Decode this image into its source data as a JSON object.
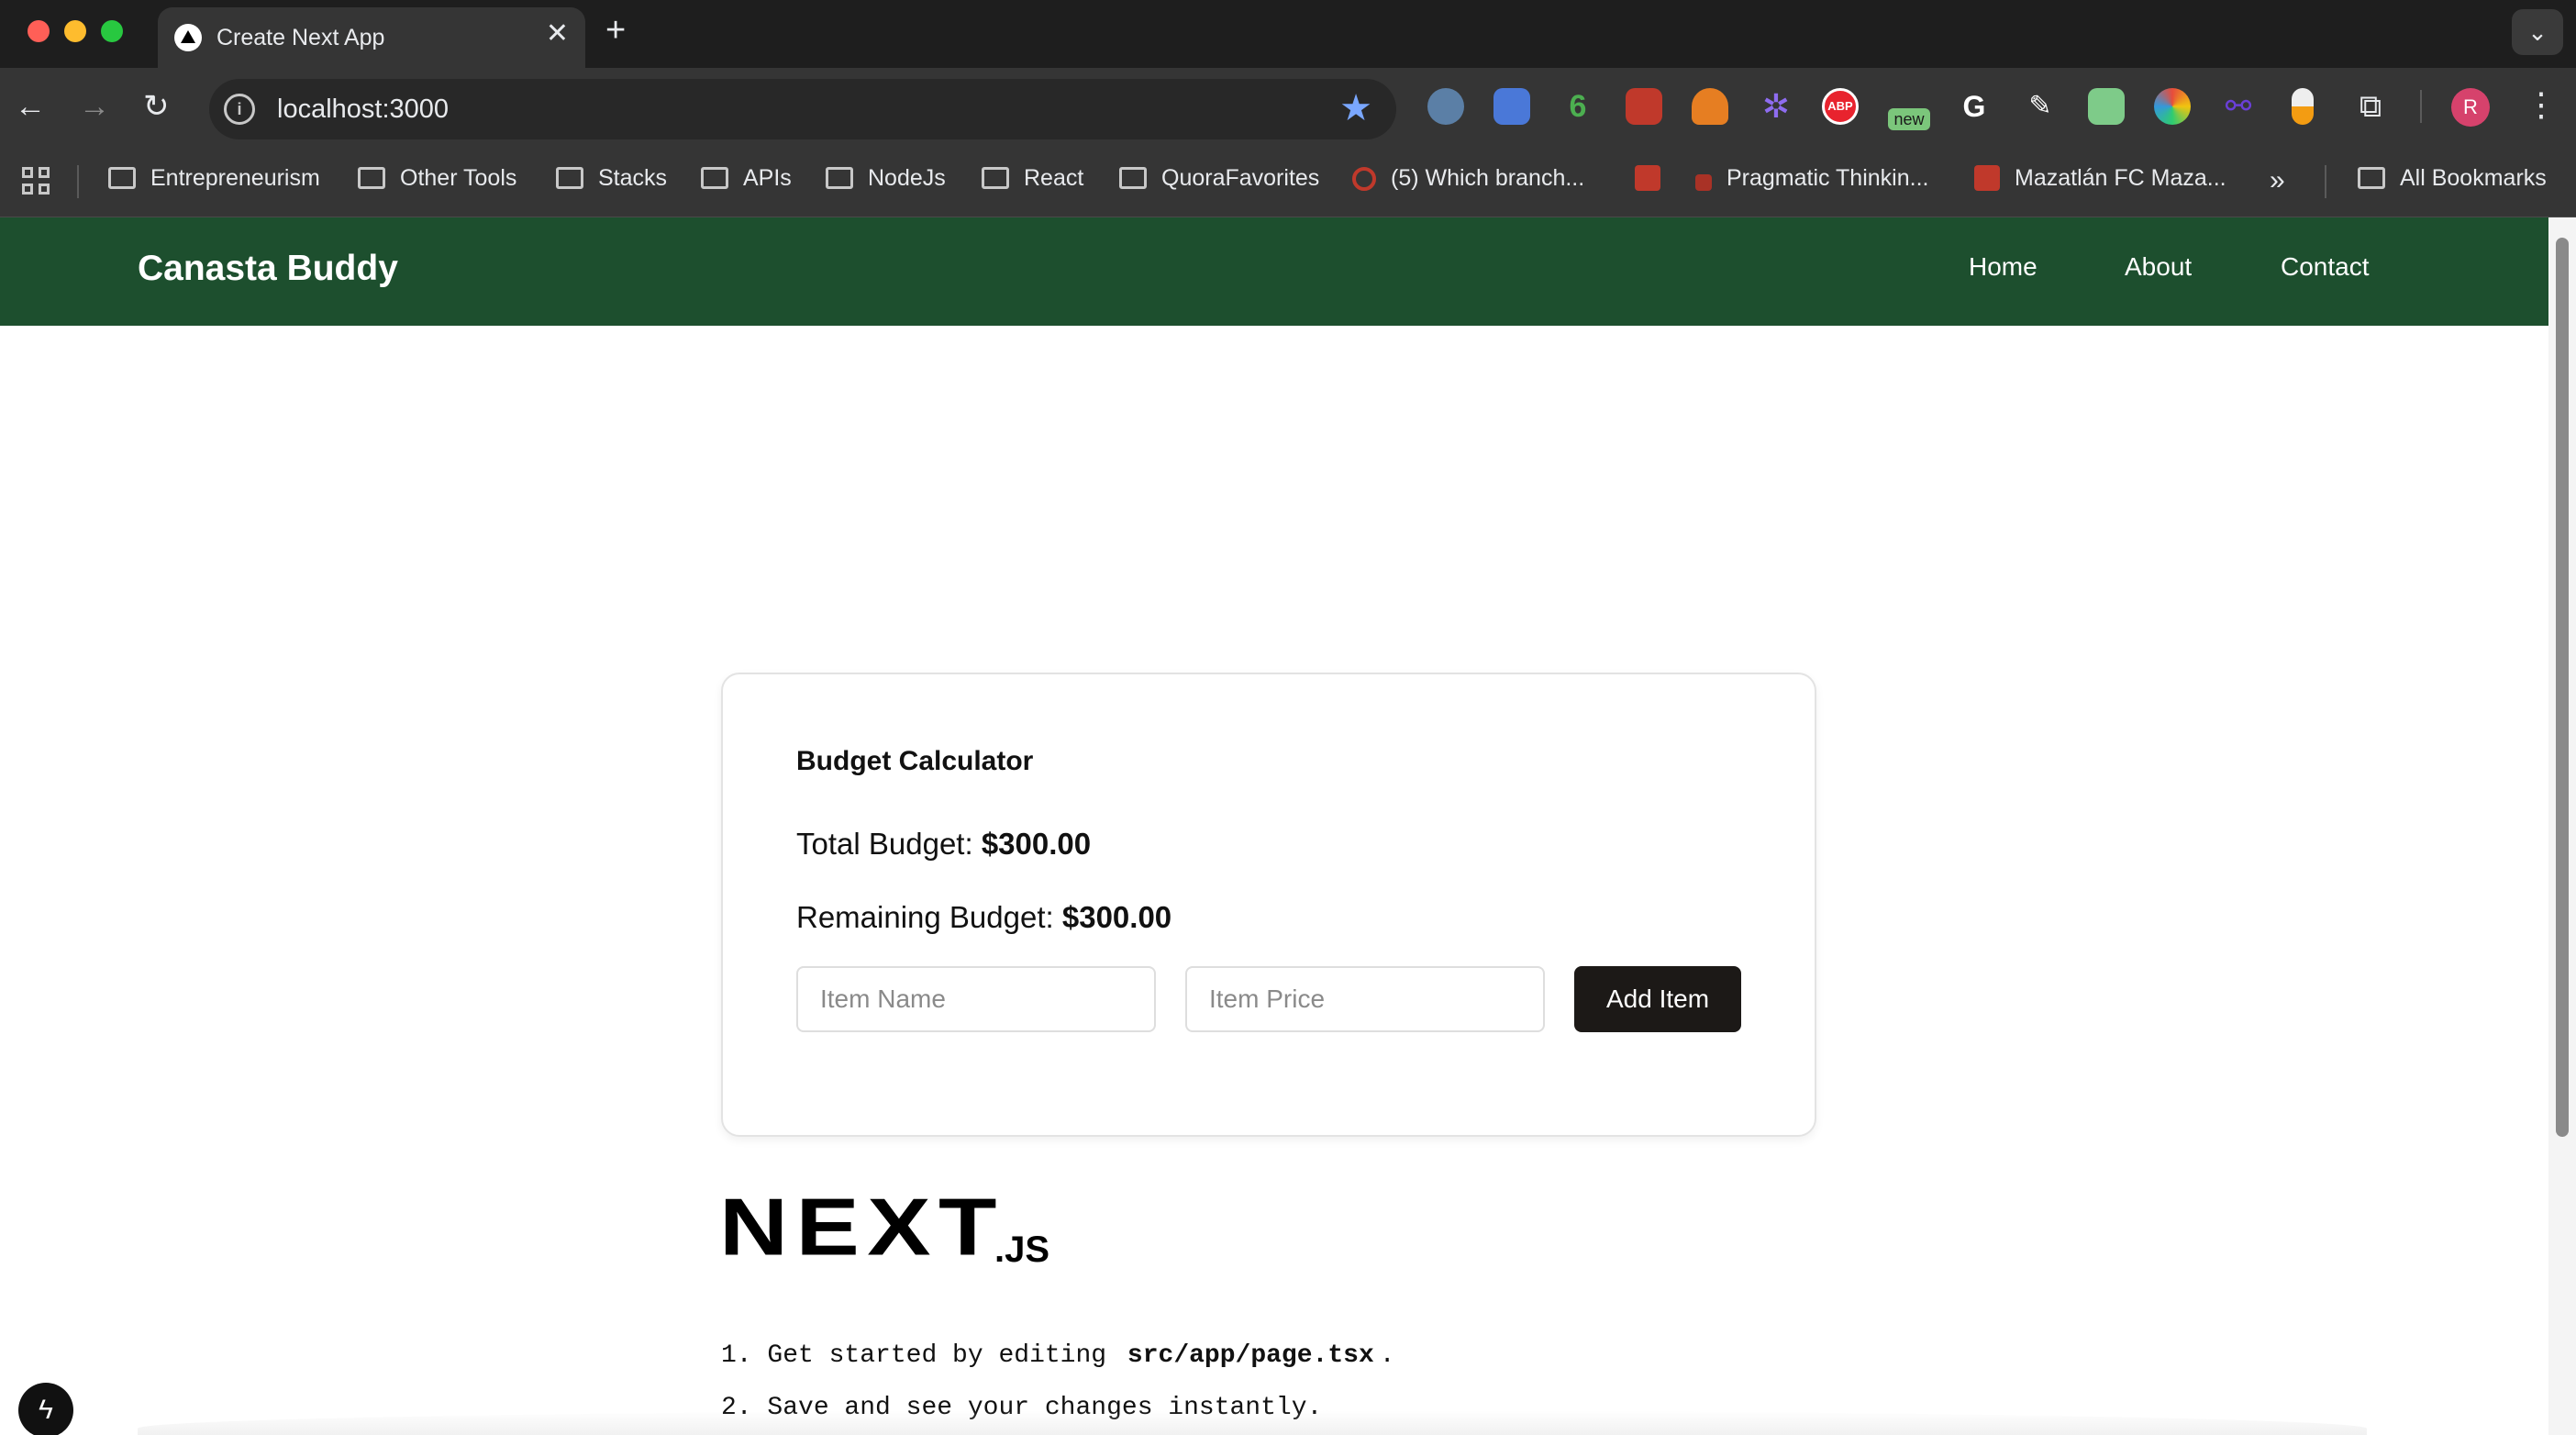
{
  "browser": {
    "tab_title": "Create Next App",
    "url": "localhost:3000",
    "profile_initial": "R",
    "bookmarks": [
      {
        "label": "Entrepreneurism",
        "icon": "folder-icon"
      },
      {
        "label": "Other Tools",
        "icon": "folder-icon"
      },
      {
        "label": "Stacks",
        "icon": "folder-icon"
      },
      {
        "label": "APIs",
        "icon": "folder-icon"
      },
      {
        "label": "NodeJs",
        "icon": "folder-icon"
      },
      {
        "label": "React",
        "icon": "folder-icon"
      },
      {
        "label": "QuoraFavorites",
        "icon": "folder-icon"
      },
      {
        "label": "(5) Which branch...",
        "icon": "quora-icon"
      },
      {
        "label": "Pragmatic Thinkin...",
        "icon": "site-icon"
      },
      {
        "label": "Mazatlán FC Maza...",
        "icon": "site-icon"
      }
    ],
    "all_bookmarks": "All Bookmarks",
    "extension_badge": "new",
    "extension_abp": "ABP",
    "extension_six": "6"
  },
  "app": {
    "brand": "Canasta Buddy",
    "nav": [
      "Home",
      "About",
      "Contact"
    ],
    "accent": "#1d4f2e"
  },
  "budget": {
    "title": "Budget Calculator",
    "total_label": "Total Budget:",
    "total_value": "$300.00",
    "remaining_label": "Remaining Budget:",
    "remaining_value": "$300.00",
    "item_name_placeholder": "Item Name",
    "item_price_placeholder": "Item Price",
    "add_button": "Add Item"
  },
  "next": {
    "logo_main": "NEXT",
    "logo_suffix": ".JS",
    "step1_prefix": "Get started by editing",
    "step1_code": "src/app/page.tsx",
    "step1_suffix": ".",
    "step2": "Save and see your changes instantly."
  }
}
